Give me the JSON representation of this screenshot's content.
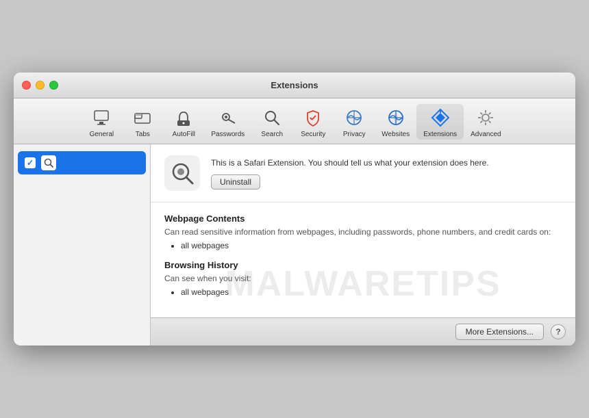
{
  "window": {
    "title": "Extensions"
  },
  "toolbar": {
    "items": [
      {
        "id": "general",
        "label": "General",
        "icon": "general-icon"
      },
      {
        "id": "tabs",
        "label": "Tabs",
        "icon": "tabs-icon"
      },
      {
        "id": "autofill",
        "label": "AutoFill",
        "icon": "autofill-icon"
      },
      {
        "id": "passwords",
        "label": "Passwords",
        "icon": "passwords-icon"
      },
      {
        "id": "search",
        "label": "Search",
        "icon": "search-icon"
      },
      {
        "id": "security",
        "label": "Security",
        "icon": "security-icon"
      },
      {
        "id": "privacy",
        "label": "Privacy",
        "icon": "privacy-icon"
      },
      {
        "id": "websites",
        "label": "Websites",
        "icon": "websites-icon"
      },
      {
        "id": "extensions",
        "label": "Extensions",
        "icon": "extensions-icon",
        "active": true
      },
      {
        "id": "advanced",
        "label": "Advanced",
        "icon": "advanced-icon"
      }
    ]
  },
  "sidebar": {
    "items": [
      {
        "id": "search-ext",
        "label": "",
        "checked": true,
        "selected": true
      }
    ]
  },
  "extension": {
    "description": "This is a Safari Extension. You should tell us what your extension does here.",
    "uninstall_label": "Uninstall"
  },
  "permissions": [
    {
      "title": "Webpage Contents",
      "description": "Can read sensitive information from webpages, including passwords, phone numbers, and credit cards on:",
      "items": [
        "all webpages"
      ]
    },
    {
      "title": "Browsing History",
      "description": "Can see when you visit:",
      "items": [
        "all webpages"
      ]
    }
  ],
  "footer": {
    "more_extensions_label": "More Extensions...",
    "help_label": "?"
  },
  "watermark": "MALWARETIPS"
}
